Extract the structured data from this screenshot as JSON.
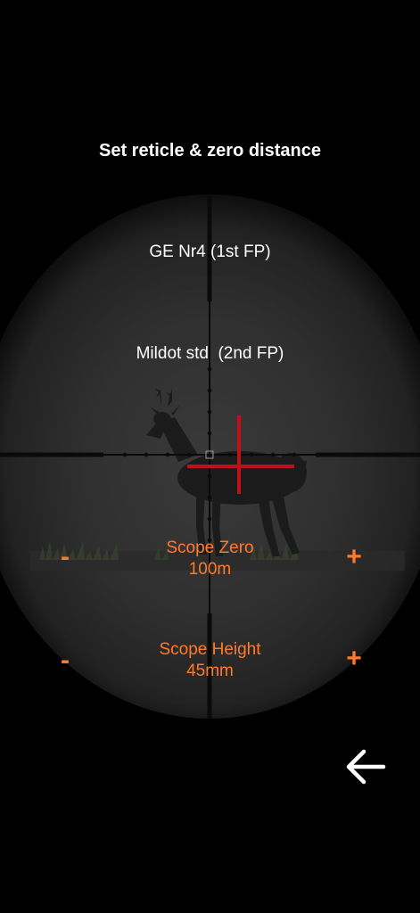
{
  "header": {
    "title": "Set reticle & zero distance"
  },
  "reticles": {
    "option_1": "GE Nr4 (1st FP)",
    "option_2": "Mildot std  (2nd FP)"
  },
  "scope_zero": {
    "label": "Scope Zero",
    "value": "100m",
    "minus": "-",
    "plus": "+"
  },
  "scope_height": {
    "label": "Scope Height",
    "value": "45mm",
    "minus": "-",
    "plus": "+"
  },
  "colors": {
    "accent": "#ff7a2a",
    "text": "#ffffff",
    "background": "#000000",
    "reticle_red": "#c0101a"
  },
  "icons": {
    "back": "arrow-left-icon"
  }
}
